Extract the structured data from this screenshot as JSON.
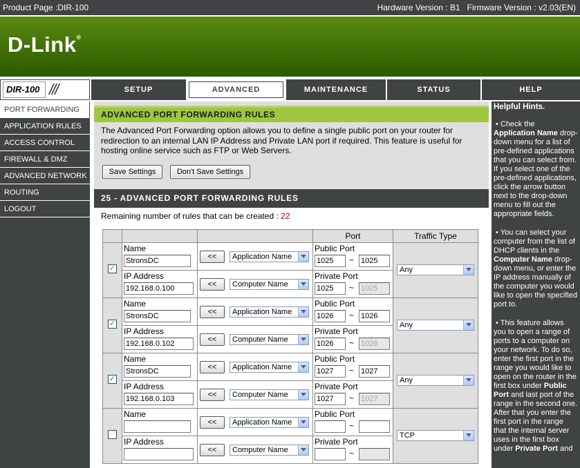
{
  "topbar": {
    "product": "Product Page :DIR-100",
    "versions": "Hardware Version : B1   Firmware Version : v2.03(EN)"
  },
  "brand": {
    "logo": "D-Link",
    "trademark": "®"
  },
  "model": {
    "name": "DIR-100",
    "slashes": "///"
  },
  "nav": {
    "tabs": [
      {
        "label": "SETUP"
      },
      {
        "label": "ADVANCED"
      },
      {
        "label": "MAINTENANCE"
      },
      {
        "label": "STATUS"
      },
      {
        "label": "HELP"
      }
    ],
    "active": "ADVANCED"
  },
  "sidebar": {
    "items": [
      {
        "label": "PORT FORWARDING"
      },
      {
        "label": "APPLICATION RULES"
      },
      {
        "label": "ACCESS CONTROL"
      },
      {
        "label": "FIREWALL & DMZ"
      },
      {
        "label": "ADVANCED NETWORK"
      },
      {
        "label": "ROUTING"
      },
      {
        "label": "LOGOUT"
      }
    ]
  },
  "intro_box": {
    "title": "ADVANCED PORT FORWARDING RULES",
    "text": "The Advanced Port Forwarding option allows you to define a single public port on your router for redirection to an internal LAN IP Address and Private LAN port if required. This feature is useful for hosting online service such as FTP or Web Servers.",
    "save_label": "Save Settings",
    "dont_save_label": "Don't Save Settings"
  },
  "rules_panel": {
    "title": "25 - ADVANCED PORT FORWARDING RULES",
    "remaining_label": "Remaining number of rules that can be created :",
    "remaining_value": "22",
    "headers": {
      "port": "Port",
      "traffic": "Traffic Type"
    },
    "labels": {
      "name": "Name",
      "ip": "IP Address",
      "public_port": "Public Port",
      "private_port": "Private Port",
      "arrow_button": "<<",
      "app_select": "Application Name",
      "computer_select": "Computer Name",
      "tilde": "~"
    },
    "rules": [
      {
        "checked": true,
        "check_mark": "✓",
        "name": "StronsDC",
        "ip": "192.168.0.100",
        "public_start": "1025",
        "public_end": "1025",
        "private_start": "1025",
        "private_end": "1025",
        "traffic": "Any"
      },
      {
        "checked": true,
        "check_mark": "✓",
        "name": "StronsDC",
        "ip": "192.168.0.102",
        "public_start": "1026",
        "public_end": "1026",
        "private_start": "1026",
        "private_end": "1026",
        "traffic": "Any"
      },
      {
        "checked": true,
        "check_mark": "✓",
        "name": "StronsDC",
        "ip": "192.168.0.103",
        "public_start": "1027",
        "public_end": "1027",
        "private_start": "1027",
        "private_end": "1027",
        "traffic": "Any"
      },
      {
        "checked": false,
        "check_mark": "",
        "name": "",
        "ip": "",
        "public_start": "",
        "public_end": "",
        "private_start": "",
        "private_end": "",
        "traffic": "TCP"
      }
    ]
  },
  "hints": {
    "title": "Helpful Hints.",
    "h1_pre": "Check the",
    "h1_bold": "Application Name",
    "h1_post": "drop-down menu for a list of pre-defined applications that you can select from. If you select one of the pre-defined applications, click the arrow button next to the drop-down menu to fill out the appropriate fields.",
    "h2_pre": "You can select your computer from the list of DHCP clients in the",
    "h2_bold": "Computer Name",
    "h2_post": "drop-down menu, or enter the IP address manually of the computer you would like to open the specified port to.",
    "h3_pre": "This feature allows you to open a range of ports to a computer on your network. To do so, enter the first port in the range you would like to open on the router in the first box under",
    "h3_bold1": "Public Port",
    "h3_mid": "and last port of the range in the second one. After that you enter the first port in the range that the internal server uses in the first box under",
    "h3_bold2": "Private Port",
    "h3_post": "and"
  }
}
